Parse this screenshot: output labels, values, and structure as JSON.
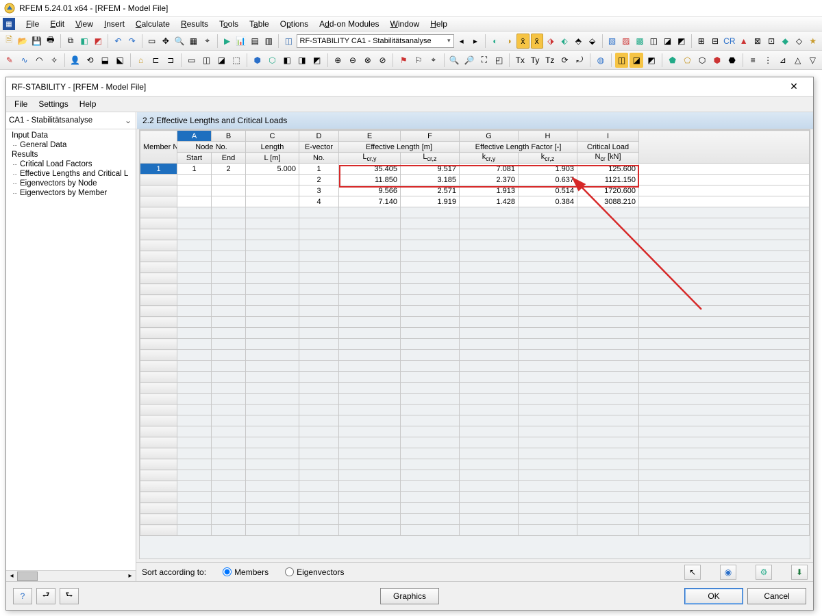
{
  "app": {
    "title": "RFEM 5.24.01 x64 - [RFEM - Model File]"
  },
  "mainMenu": [
    "File",
    "Edit",
    "View",
    "Insert",
    "Calculate",
    "Results",
    "Tools",
    "Table",
    "Options",
    "Add-on Modules",
    "Window",
    "Help"
  ],
  "mainCombo": "RF-STABILITY CA1 - Stabilitätsanalyse",
  "dialog": {
    "title": "RF-STABILITY - [RFEM - Model File]",
    "menu": [
      "File",
      "Settings",
      "Help"
    ],
    "caseCombo": "CA1 - Stabilitätsanalyse",
    "panelTitle": "2.2 Effective Lengths and Critical Loads",
    "tree": {
      "inputData": "Input Data",
      "generalData": "General Data",
      "results": "Results",
      "criticalLoadFactors": "Critical Load Factors",
      "effLengths": "Effective Lengths and Critical L",
      "eigByNode": "Eigenvectors by Node",
      "eigByMember": "Eigenvectors by Member"
    },
    "columnsLetters": [
      "A",
      "B",
      "C",
      "D",
      "E",
      "F",
      "G",
      "H",
      "I"
    ],
    "header": {
      "memberNo": "Member No.",
      "nodeNo": "Node No.",
      "length": "Length",
      "evector": "E-vector",
      "effLen": "Effective Length [m]",
      "effFactor": "Effective Length Factor [-]",
      "critLoad": "Critical Load",
      "start": "Start",
      "end": "End",
      "Lm": "L [m]",
      "No": "No.",
      "Lcry": "Lcr,y",
      "Lcrz": "Lcr,z",
      "kcry": "kcr,y",
      "kcrz": "kcr,z",
      "Ncr": "Ncr [kN]"
    },
    "rows": [
      {
        "member": "1",
        "start": "1",
        "end": "2",
        "L": "5.000",
        "ev": "1",
        "Lcry": "35.405",
        "Lcrz": "9.517",
        "kcry": "7.081",
        "kcrz": "1.903",
        "Ncr": "125.600"
      },
      {
        "member": "",
        "start": "",
        "end": "",
        "L": "",
        "ev": "2",
        "Lcry": "11.850",
        "Lcrz": "3.185",
        "kcry": "2.370",
        "kcrz": "0.637",
        "Ncr": "1121.150"
      },
      {
        "member": "",
        "start": "",
        "end": "",
        "L": "",
        "ev": "3",
        "Lcry": "9.566",
        "Lcrz": "2.571",
        "kcry": "1.913",
        "kcrz": "0.514",
        "Ncr": "1720.600"
      },
      {
        "member": "",
        "start": "",
        "end": "",
        "L": "",
        "ev": "4",
        "Lcry": "7.140",
        "Lcrz": "1.919",
        "kcry": "1.428",
        "kcrz": "0.384",
        "Ncr": "3088.210"
      }
    ],
    "sortLabel": "Sort according to:",
    "sortMembers": "Members",
    "sortEigen": "Eigenvectors",
    "graphicsBtn": "Graphics",
    "okBtn": "OK",
    "cancelBtn": "Cancel"
  }
}
